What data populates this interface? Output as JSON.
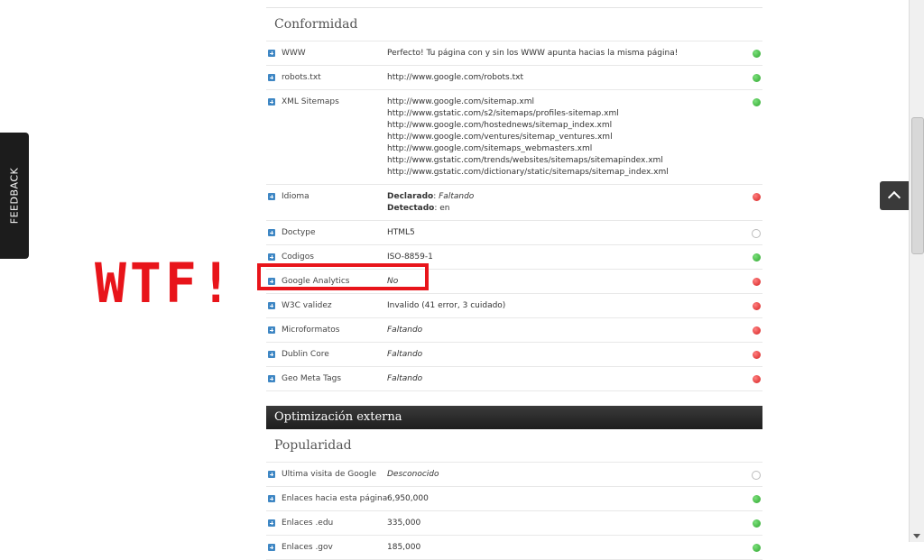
{
  "feedback_tab": {
    "label": "FEEDBACK"
  },
  "annotation": {
    "text": "WTF!"
  },
  "sections": {
    "conformidad": {
      "title": "Conformidad",
      "rows": [
        {
          "label": "WWW",
          "values": [
            "Perfecto! Tu página con y sin los WWW apunta hacias la misma página!"
          ],
          "status": "green"
        },
        {
          "label": "robots.txt",
          "values": [
            "http://www.google.com/robots.txt"
          ],
          "status": "green"
        },
        {
          "label": "XML Sitemaps",
          "values": [
            "http://www.google.com/sitemap.xml",
            "http://www.gstatic.com/s2/sitemaps/profiles-sitemap.xml",
            "http://www.google.com/hostednews/sitemap_index.xml",
            "http://www.google.com/ventures/sitemap_ventures.xml",
            "http://www.google.com/sitemaps_webmasters.xml",
            "http://www.gstatic.com/trends/websites/sitemaps/sitemapindex.xml",
            "http://www.gstatic.com/dictionary/static/sitemaps/sitemap_index.xml"
          ],
          "status": "green"
        },
        {
          "label": "Idioma",
          "declarado_label": "Declarado",
          "declarado_value": "Faltando",
          "detectado_label": "Detectado",
          "detectado_value": "en",
          "status": "red"
        },
        {
          "label": "Doctype",
          "values": [
            "HTML5"
          ],
          "status": "empty"
        },
        {
          "label": "Codigos",
          "values": [
            "ISO-8859-1"
          ],
          "status": "green"
        },
        {
          "label": "Google Analytics",
          "values": [
            "No"
          ],
          "italic": true,
          "status": "red"
        },
        {
          "label": "W3C validez",
          "values": [
            "Invalido (41 error, 3 cuidado)"
          ],
          "status": "red"
        },
        {
          "label": "Microformatos",
          "values": [
            "Faltando"
          ],
          "italic": true,
          "status": "red"
        },
        {
          "label": "Dublin Core",
          "values": [
            "Faltando"
          ],
          "italic": true,
          "status": "red"
        },
        {
          "label": "Geo Meta Tags",
          "values": [
            "Faltando"
          ],
          "italic": true,
          "status": "red"
        }
      ]
    },
    "externa": {
      "title": "Optimización externa"
    },
    "popularidad": {
      "title": "Popularidad",
      "rows": [
        {
          "label": "Ultima visita de Google",
          "values": [
            "Desconocido"
          ],
          "italic": true,
          "status": "empty"
        },
        {
          "label": "Enlaces hacia esta página",
          "values": [
            "6,950,000"
          ],
          "status": "green"
        },
        {
          "label": "Enlaces .edu",
          "values": [
            "335,000"
          ],
          "status": "green"
        },
        {
          "label": "Enlaces .gov",
          "values": [
            "185,000"
          ],
          "status": "green"
        }
      ]
    }
  },
  "colors": {
    "status_green": "#2ea52e",
    "status_red": "#d42020",
    "annotation_red": "#e8141a",
    "header_dark": "#1e1e1e"
  }
}
